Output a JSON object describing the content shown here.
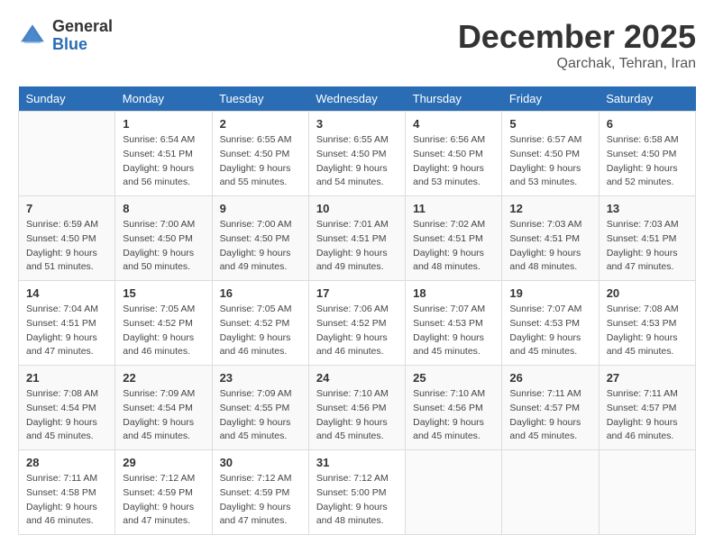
{
  "header": {
    "logo_general": "General",
    "logo_blue": "Blue",
    "month_title": "December 2025",
    "location": "Qarchak, Tehran, Iran"
  },
  "calendar": {
    "weekdays": [
      "Sunday",
      "Monday",
      "Tuesday",
      "Wednesday",
      "Thursday",
      "Friday",
      "Saturday"
    ],
    "weeks": [
      [
        {
          "day": "",
          "sunrise": "",
          "sunset": "",
          "daylight": ""
        },
        {
          "day": "1",
          "sunrise": "Sunrise: 6:54 AM",
          "sunset": "Sunset: 4:51 PM",
          "daylight": "Daylight: 9 hours and 56 minutes."
        },
        {
          "day": "2",
          "sunrise": "Sunrise: 6:55 AM",
          "sunset": "Sunset: 4:50 PM",
          "daylight": "Daylight: 9 hours and 55 minutes."
        },
        {
          "day": "3",
          "sunrise": "Sunrise: 6:55 AM",
          "sunset": "Sunset: 4:50 PM",
          "daylight": "Daylight: 9 hours and 54 minutes."
        },
        {
          "day": "4",
          "sunrise": "Sunrise: 6:56 AM",
          "sunset": "Sunset: 4:50 PM",
          "daylight": "Daylight: 9 hours and 53 minutes."
        },
        {
          "day": "5",
          "sunrise": "Sunrise: 6:57 AM",
          "sunset": "Sunset: 4:50 PM",
          "daylight": "Daylight: 9 hours and 53 minutes."
        },
        {
          "day": "6",
          "sunrise": "Sunrise: 6:58 AM",
          "sunset": "Sunset: 4:50 PM",
          "daylight": "Daylight: 9 hours and 52 minutes."
        }
      ],
      [
        {
          "day": "7",
          "sunrise": "Sunrise: 6:59 AM",
          "sunset": "Sunset: 4:50 PM",
          "daylight": "Daylight: 9 hours and 51 minutes."
        },
        {
          "day": "8",
          "sunrise": "Sunrise: 7:00 AM",
          "sunset": "Sunset: 4:50 PM",
          "daylight": "Daylight: 9 hours and 50 minutes."
        },
        {
          "day": "9",
          "sunrise": "Sunrise: 7:00 AM",
          "sunset": "Sunset: 4:50 PM",
          "daylight": "Daylight: 9 hours and 49 minutes."
        },
        {
          "day": "10",
          "sunrise": "Sunrise: 7:01 AM",
          "sunset": "Sunset: 4:51 PM",
          "daylight": "Daylight: 9 hours and 49 minutes."
        },
        {
          "day": "11",
          "sunrise": "Sunrise: 7:02 AM",
          "sunset": "Sunset: 4:51 PM",
          "daylight": "Daylight: 9 hours and 48 minutes."
        },
        {
          "day": "12",
          "sunrise": "Sunrise: 7:03 AM",
          "sunset": "Sunset: 4:51 PM",
          "daylight": "Daylight: 9 hours and 48 minutes."
        },
        {
          "day": "13",
          "sunrise": "Sunrise: 7:03 AM",
          "sunset": "Sunset: 4:51 PM",
          "daylight": "Daylight: 9 hours and 47 minutes."
        }
      ],
      [
        {
          "day": "14",
          "sunrise": "Sunrise: 7:04 AM",
          "sunset": "Sunset: 4:51 PM",
          "daylight": "Daylight: 9 hours and 47 minutes."
        },
        {
          "day": "15",
          "sunrise": "Sunrise: 7:05 AM",
          "sunset": "Sunset: 4:52 PM",
          "daylight": "Daylight: 9 hours and 46 minutes."
        },
        {
          "day": "16",
          "sunrise": "Sunrise: 7:05 AM",
          "sunset": "Sunset: 4:52 PM",
          "daylight": "Daylight: 9 hours and 46 minutes."
        },
        {
          "day": "17",
          "sunrise": "Sunrise: 7:06 AM",
          "sunset": "Sunset: 4:52 PM",
          "daylight": "Daylight: 9 hours and 46 minutes."
        },
        {
          "day": "18",
          "sunrise": "Sunrise: 7:07 AM",
          "sunset": "Sunset: 4:53 PM",
          "daylight": "Daylight: 9 hours and 45 minutes."
        },
        {
          "day": "19",
          "sunrise": "Sunrise: 7:07 AM",
          "sunset": "Sunset: 4:53 PM",
          "daylight": "Daylight: 9 hours and 45 minutes."
        },
        {
          "day": "20",
          "sunrise": "Sunrise: 7:08 AM",
          "sunset": "Sunset: 4:53 PM",
          "daylight": "Daylight: 9 hours and 45 minutes."
        }
      ],
      [
        {
          "day": "21",
          "sunrise": "Sunrise: 7:08 AM",
          "sunset": "Sunset: 4:54 PM",
          "daylight": "Daylight: 9 hours and 45 minutes."
        },
        {
          "day": "22",
          "sunrise": "Sunrise: 7:09 AM",
          "sunset": "Sunset: 4:54 PM",
          "daylight": "Daylight: 9 hours and 45 minutes."
        },
        {
          "day": "23",
          "sunrise": "Sunrise: 7:09 AM",
          "sunset": "Sunset: 4:55 PM",
          "daylight": "Daylight: 9 hours and 45 minutes."
        },
        {
          "day": "24",
          "sunrise": "Sunrise: 7:10 AM",
          "sunset": "Sunset: 4:56 PM",
          "daylight": "Daylight: 9 hours and 45 minutes."
        },
        {
          "day": "25",
          "sunrise": "Sunrise: 7:10 AM",
          "sunset": "Sunset: 4:56 PM",
          "daylight": "Daylight: 9 hours and 45 minutes."
        },
        {
          "day": "26",
          "sunrise": "Sunrise: 7:11 AM",
          "sunset": "Sunset: 4:57 PM",
          "daylight": "Daylight: 9 hours and 45 minutes."
        },
        {
          "day": "27",
          "sunrise": "Sunrise: 7:11 AM",
          "sunset": "Sunset: 4:57 PM",
          "daylight": "Daylight: 9 hours and 46 minutes."
        }
      ],
      [
        {
          "day": "28",
          "sunrise": "Sunrise: 7:11 AM",
          "sunset": "Sunset: 4:58 PM",
          "daylight": "Daylight: 9 hours and 46 minutes."
        },
        {
          "day": "29",
          "sunrise": "Sunrise: 7:12 AM",
          "sunset": "Sunset: 4:59 PM",
          "daylight": "Daylight: 9 hours and 47 minutes."
        },
        {
          "day": "30",
          "sunrise": "Sunrise: 7:12 AM",
          "sunset": "Sunset: 4:59 PM",
          "daylight": "Daylight: 9 hours and 47 minutes."
        },
        {
          "day": "31",
          "sunrise": "Sunrise: 7:12 AM",
          "sunset": "Sunset: 5:00 PM",
          "daylight": "Daylight: 9 hours and 48 minutes."
        },
        {
          "day": "",
          "sunrise": "",
          "sunset": "",
          "daylight": ""
        },
        {
          "day": "",
          "sunrise": "",
          "sunset": "",
          "daylight": ""
        },
        {
          "day": "",
          "sunrise": "",
          "sunset": "",
          "daylight": ""
        }
      ]
    ]
  }
}
